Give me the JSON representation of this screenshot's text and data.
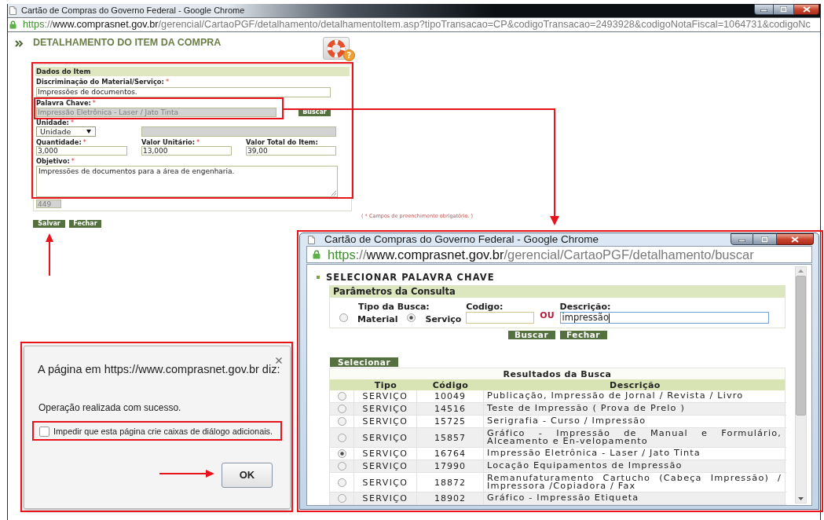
{
  "main_window": {
    "title": "Cartão de Compras do Governo Federal - Google Chrome",
    "url": [
      {
        "kind": "scheme",
        "text": "https"
      },
      {
        "kind": "separator",
        "text": "://"
      },
      {
        "kind": "host",
        "text": "www.comprasnet.gov.br"
      },
      {
        "kind": "path",
        "text": "/gerencial/CartaoPGF/detalhamento/detalhamentoItem.asp?tipoTransacao=CP&codigoTransacao=2493928&codigoNotaFiscal=1064731&codigoNc"
      }
    ],
    "page": {
      "heading": "DETALHAMENTO DO ITEM DA COMPRA",
      "help_badge": "?",
      "form": {
        "title": "Dados do Item",
        "description": {
          "label": "Discriminação do Material/Serviço:",
          "required_mark": "*",
          "value": "Impressões de documentos."
        },
        "keyword": {
          "label": "Palavra Chave:",
          "required_mark": "*",
          "value": "Impressão Eletrônica - Laser / Jato Tinta",
          "disabled": true
        },
        "keyword_button": "Buscar",
        "unit": {
          "label": "Unidade:",
          "required_mark": "*",
          "value": "Unidade"
        },
        "unit_detail": {
          "disabled": true
        },
        "amounts": [
          {
            "label": "Quantidade:",
            "required_mark": "*",
            "value": "3,000"
          },
          {
            "label": "Valor Unitário:",
            "required_mark": "*",
            "value": "13,000"
          },
          {
            "label": "Valor Total do Item:",
            "value": "39,00"
          }
        ],
        "objective": {
          "label": "Objetivo:",
          "required_mark": "*",
          "value": "Impressões de documentos para a área de engenharia."
        },
        "char_counter": "449"
      },
      "required_note": "( * Campos de preenchimento obrigatório. )",
      "buttons": [
        "Salvar",
        "Fechar"
      ]
    }
  },
  "alert_dialog": {
    "title": "A página em https://www.comprasnet.gov.br diz:",
    "message": "Operação realizada com sucesso.",
    "suppress_option": {
      "label": "Impedir que esta página crie caixas de diálogo adicionais.",
      "checked": false
    },
    "ok_button": "OK"
  },
  "popup_window": {
    "title": "Cartão de Compras do Governo Federal - Google Chrome",
    "url": [
      {
        "kind": "scheme",
        "text": "https"
      },
      {
        "kind": "separator",
        "text": "://"
      },
      {
        "kind": "host",
        "text": "www.comprasnet.gov.br"
      },
      {
        "kind": "path",
        "text": "/gerencial/CartaoPGF/detalhamento/buscar"
      }
    ],
    "heading": "SELECIONAR PALAVRA CHAVE",
    "query_panel": {
      "title": "Parâmetros da Consulta",
      "search_type": {
        "label": "Tipo da Busca:",
        "options": [
          {
            "label": "Material",
            "selected": false
          },
          {
            "label": "Serviço",
            "selected": true
          }
        ]
      },
      "code_field": {
        "label": "Codigo:"
      },
      "or_label": "OU",
      "description_field": {
        "label": "Descrição:",
        "value": "impressão",
        "focused": true
      }
    },
    "buttons": [
      "Buscar",
      "Fechar"
    ],
    "select_button": "Selecionar",
    "results": {
      "title": "Resultados da Busca",
      "columns": [
        "Tipo",
        "Código",
        "Descrição"
      ],
      "rows": [
        {
          "selected": false,
          "type": "SERVIÇO",
          "code": "10049",
          "description": "Publicação, Impressão de Jornal / Revista / Livro"
        },
        {
          "selected": false,
          "type": "SERVIÇO",
          "code": "14516",
          "description": "Teste de Impressão ( Prova de Prelo )"
        },
        {
          "selected": false,
          "type": "SERVIÇO",
          "code": "15725",
          "description": "Serigrafia - Curso / Impressão"
        },
        {
          "selected": false,
          "type": "SERVIÇO",
          "code": "15857",
          "description": "Gráfico - Impressão de Manual e Formulário, Alceamento e En-velopamento"
        },
        {
          "selected": true,
          "type": "SERVIÇO",
          "code": "16764",
          "description": "Impressão Eletrônica - Laser / Jato Tinta"
        },
        {
          "selected": false,
          "type": "SERVIÇO",
          "code": "17990",
          "description": "Locação Equipamentos de Impressão"
        },
        {
          "selected": false,
          "type": "SERVIÇO",
          "code": "18872",
          "description": "Remanufaturamento Cartucho (Cabeça Impressão) / Impressora /Copiadora / Fax"
        },
        {
          "selected": false,
          "type": "SERVIÇO",
          "code": "18902",
          "description": "Gráfico - Impressão Etiqueta"
        }
      ]
    }
  }
}
